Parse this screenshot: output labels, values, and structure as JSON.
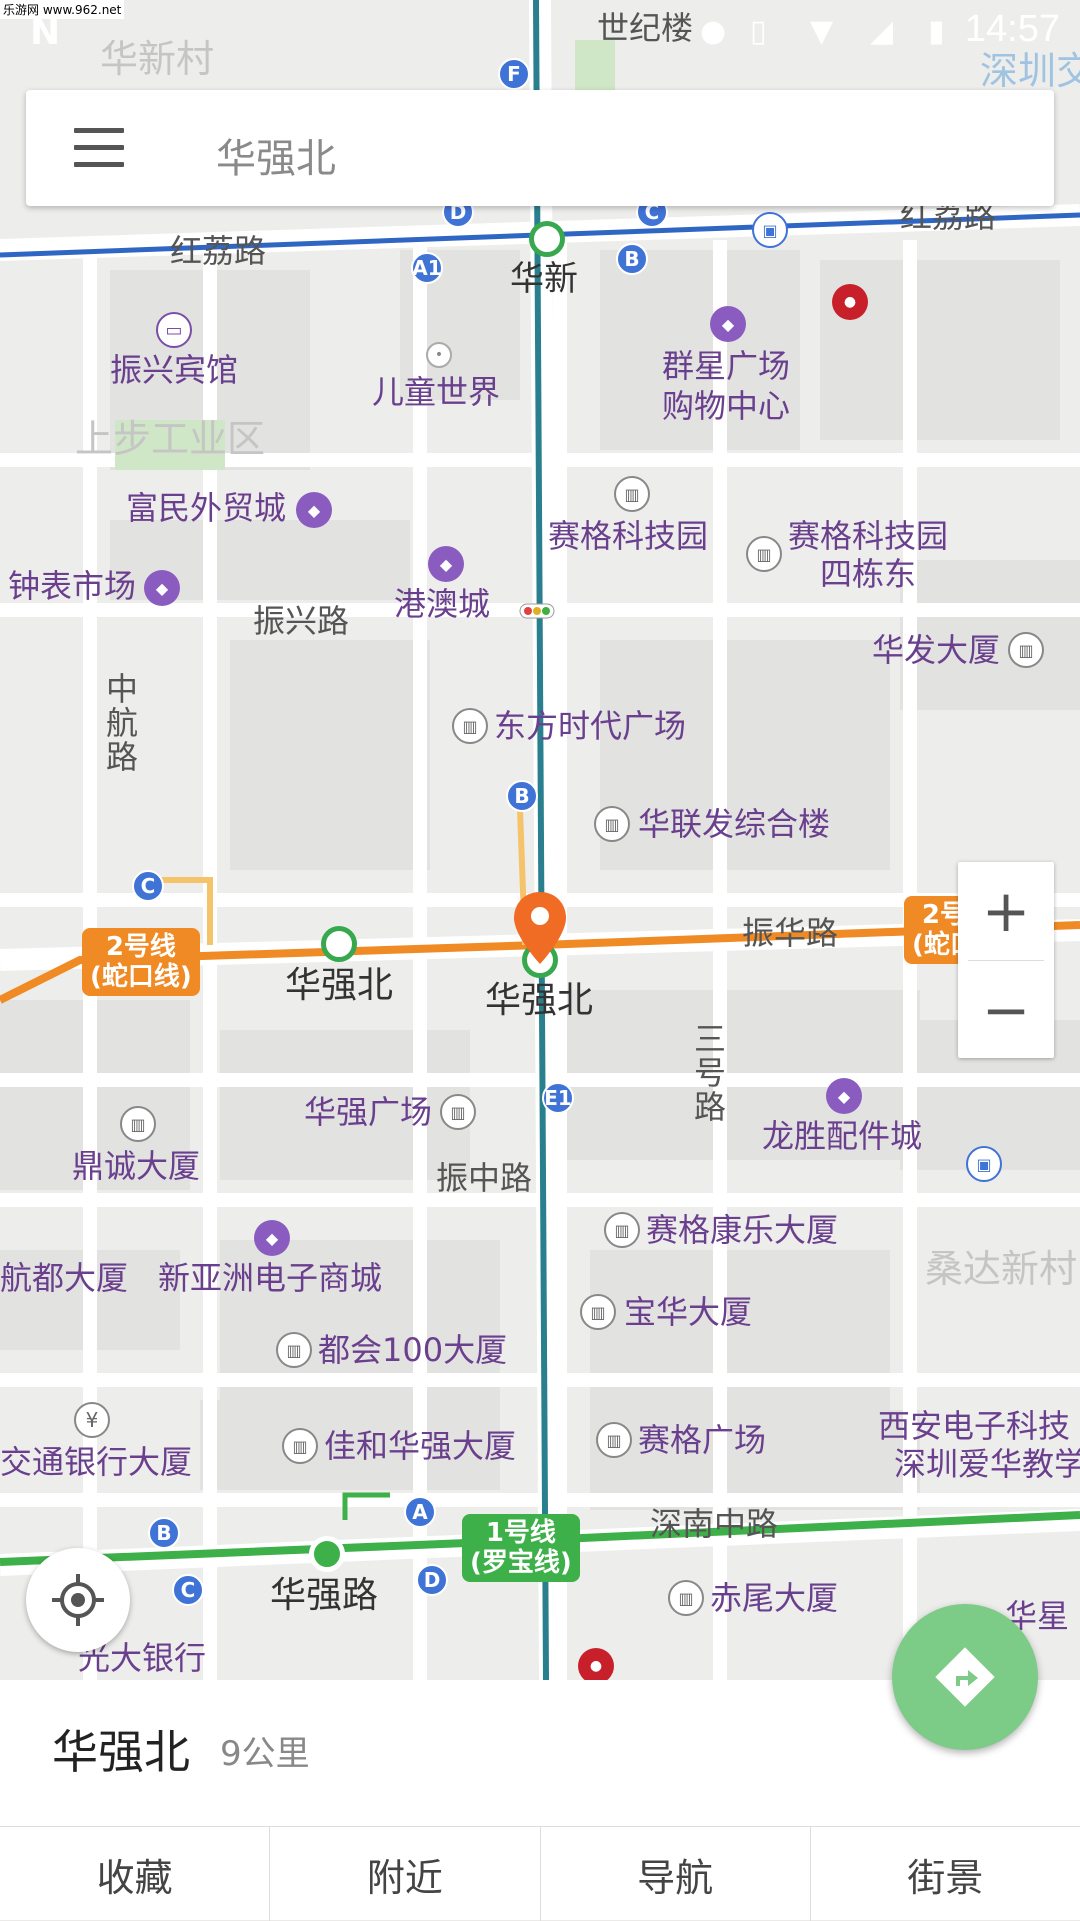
{
  "status_bar": {
    "time": "14:57",
    "watermark": "乐游网 www.962.net",
    "partial_text": "世纪楼"
  },
  "search": {
    "placeholder": "华强北"
  },
  "map": {
    "districts": [
      "华新村",
      "上步工业区",
      "桑达新村",
      "深圳交"
    ],
    "roads": [
      "红荔路",
      "红荔路",
      "振兴路",
      "振华路",
      "振中路",
      "深南中路",
      "中航路",
      "三号路"
    ],
    "stations": [
      "华新",
      "华强北",
      "华强北",
      "华强路"
    ],
    "lines": [
      {
        "name": "2号线\n(蛇口线)",
        "label1": "2号线",
        "label2": "(蛇口线)",
        "color": "#f08a24"
      },
      {
        "name": "1号线\n(罗宝线)",
        "label1": "1号线",
        "label2": "(罗宝线)",
        "color": "#3eb049"
      },
      {
        "label1": "2号",
        "label2": "(蛇口"
      }
    ],
    "pois": [
      "振兴宾馆",
      "儿童世界",
      "群星广场",
      "购物中心",
      "富民外贸城",
      "赛格科技园",
      "赛格科技园",
      "四栋东",
      "钟表市场",
      "港澳城",
      "华发大厦",
      "东方时代广场",
      "华联发综合楼",
      "华强广场",
      "龙胜配件城",
      "鼎诚大厦",
      "赛格康乐大厦",
      "航都大厦",
      "新亚洲电子商城",
      "宝华大厦",
      "都会100大厦",
      "西安电子科技",
      "深圳爱华教学",
      "交通银行大厦",
      "佳和华强大厦",
      "赛格广场",
      "赤尾大厦",
      "光大银行",
      "华星"
    ],
    "exits": [
      "F",
      "D",
      "C",
      "A1",
      "B",
      "B",
      "C",
      "E1",
      "A",
      "B",
      "C",
      "D"
    ]
  },
  "sheet": {
    "title": "华强北",
    "distance": "9公里",
    "tabs": [
      "收藏",
      "附近",
      "导航",
      "街景"
    ]
  },
  "colors": {
    "line2": "#f08a24",
    "line1": "#3eb049",
    "line_blue": "#2f66c4",
    "fab": "#7ccb86",
    "pin": "#f06b24"
  }
}
